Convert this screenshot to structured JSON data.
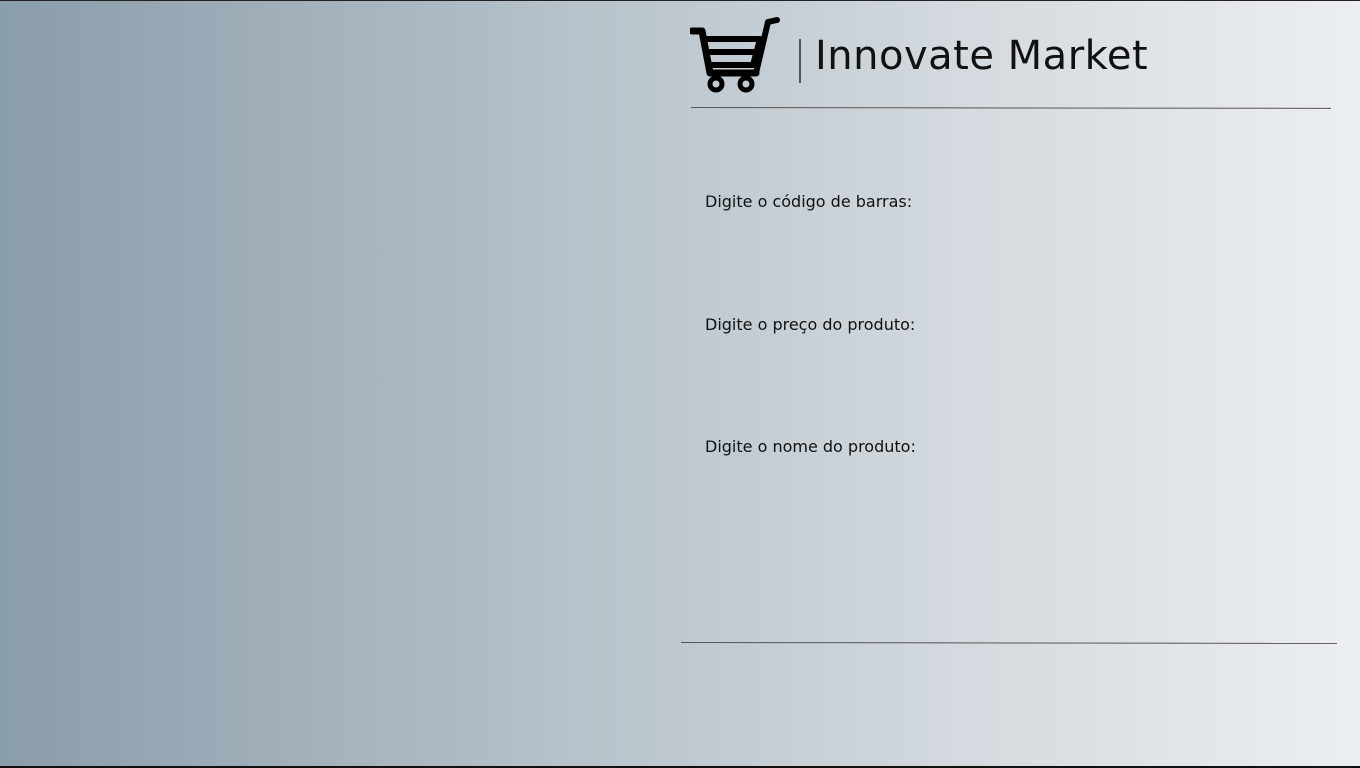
{
  "header": {
    "brand_name": "Innovate Market",
    "logo_icon": "shopping-cart-icon"
  },
  "form": {
    "fields": [
      {
        "label": "Digite o código de barras:",
        "value": "",
        "placeholder": ""
      },
      {
        "label": "Digite o preço do produto:",
        "value": "",
        "placeholder": ""
      },
      {
        "label": "Digite o nome do produto:",
        "value": "",
        "placeholder": ""
      }
    ]
  },
  "colors": {
    "gradient_left": "#8a9dab",
    "gradient_right": "#eceff1",
    "text": "#111111",
    "rule": "#555555"
  }
}
